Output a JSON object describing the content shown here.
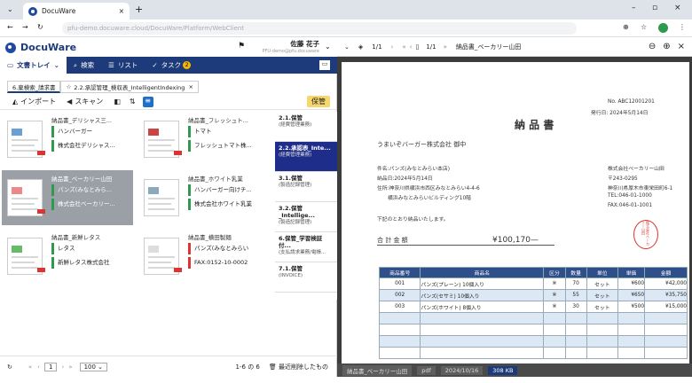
{
  "browser": {
    "tab_title": "DocuWare",
    "url": "pfu-demo.docuware.cloud/DocuWare/Platform/WebClient"
  },
  "app": {
    "logo": "DocuWare",
    "user_name": "佐藤 花子",
    "user_sub": "PFU-demo@pfu.docuware"
  },
  "menubar": {
    "items": [
      {
        "label": "文書トレイ",
        "icon": "tray-icon",
        "active": true
      },
      {
        "label": "検索",
        "icon": "search-icon"
      },
      {
        "label": "リスト",
        "icon": "list-icon"
      },
      {
        "label": "タスク",
        "icon": "check-icon",
        "badge": "2"
      }
    ]
  },
  "doc_tabs": [
    {
      "label": "6.稟検索_請求書"
    },
    {
      "label": "2.2.承認管理_検収表_IntelligentIndexing"
    }
  ],
  "actions": {
    "import": "インポート",
    "scan": "スキャン",
    "store": "保管"
  },
  "cards": [
    {
      "title": "納品書_デリシャス三...",
      "f1": "ハンバーガー",
      "f2": "株式会社デリシャス...",
      "sel": false
    },
    {
      "title": "納品書_フレッシュト...",
      "f1": "トマト",
      "f2": "フレッシュトマト株...",
      "sel": false
    },
    {
      "title": "納品書_ベーカリー山田",
      "f1": "パンズ(みなとみら...",
      "f2": "株式会社ベーカリー...",
      "sel": true
    },
    {
      "title": "納品書_ホワイト乳業",
      "f1": "ハンバーガー向けチ...",
      "f2": "株式会社ホワイト乳業",
      "sel": false
    },
    {
      "title": "納品書_新鮮レタス",
      "f1": "レタス",
      "f2": "新鮮レタス株式会社",
      "sel": false
    },
    {
      "title": "納品書_横田製麺",
      "f1": "パンズ(みなとみらい",
      "f2": "FAX:0152-10-0002",
      "sel": false,
      "red": true
    }
  ],
  "trays": [
    {
      "title": "2.1.保管",
      "sub": "(経費管理業務)"
    },
    {
      "title": "2.2.承認表_Inte...",
      "sub": "(経費管理業務)",
      "active": true
    },
    {
      "title": "3.1.保管",
      "sub": "(製造記録管理)"
    },
    {
      "title": "3.2.保管_Intellige...",
      "sub": "(製造記録管理)"
    },
    {
      "title": "6.保管_学習検証付...",
      "sub": "(支払請求業務/電帳..."
    },
    {
      "title": "7.1.保管",
      "sub": "(INVOICE)"
    }
  ],
  "footer": {
    "page": "1",
    "page_size": "100",
    "count": "1-6 の 6",
    "recent": "最近削除したもの"
  },
  "viewer": {
    "page_info": "1/1",
    "page_info2": "1/1",
    "doc_name": "納品書_ベーカリー山田",
    "file_type": "pdf",
    "date": "2024/10/16",
    "size": "308 KB"
  },
  "invoice": {
    "no": "No. ABC12001201",
    "issue_date": "発行日: 2024年5月14日",
    "title": "納 品 書",
    "to": "うまいぞバーガー株式会社 御中",
    "subject": "件名:パンズ(みなとみらい本店)",
    "deliver_date": "納品日:2024年5月14日",
    "addr1": "住所:神奈川県横浜市西区みなとみらい4-4-6",
    "addr2": "横浜みなとみらいビルディング10階",
    "company": "株式会社ベーカリー山田",
    "zip": "〒243-0295",
    "c_addr": "神奈川県厚木市東栄田町6-1",
    "tel": "TEL:046-01-1000",
    "fax": "FAX:046-01-1001",
    "note": "下記のとおり納品いたします。",
    "total_label": "合 計 金 額",
    "total": "¥100,170—",
    "stamp": "株式会社ベーカリー山田",
    "headers": [
      "商品番号",
      "商品名",
      "区分",
      "数量",
      "単位",
      "単価",
      "金額"
    ],
    "rows": [
      [
        "001",
        "パンズ(プレーン) 10個入り",
        "※",
        "70",
        "セット",
        "¥600",
        "¥42,000"
      ],
      [
        "002",
        "パンズ(セサミ) 10個入り",
        "※",
        "55",
        "セット",
        "¥650",
        "¥35,750"
      ],
      [
        "003",
        "パンズ(ホワイト) 8個入り",
        "※",
        "30",
        "セット",
        "¥500",
        "¥15,000"
      ]
    ]
  }
}
